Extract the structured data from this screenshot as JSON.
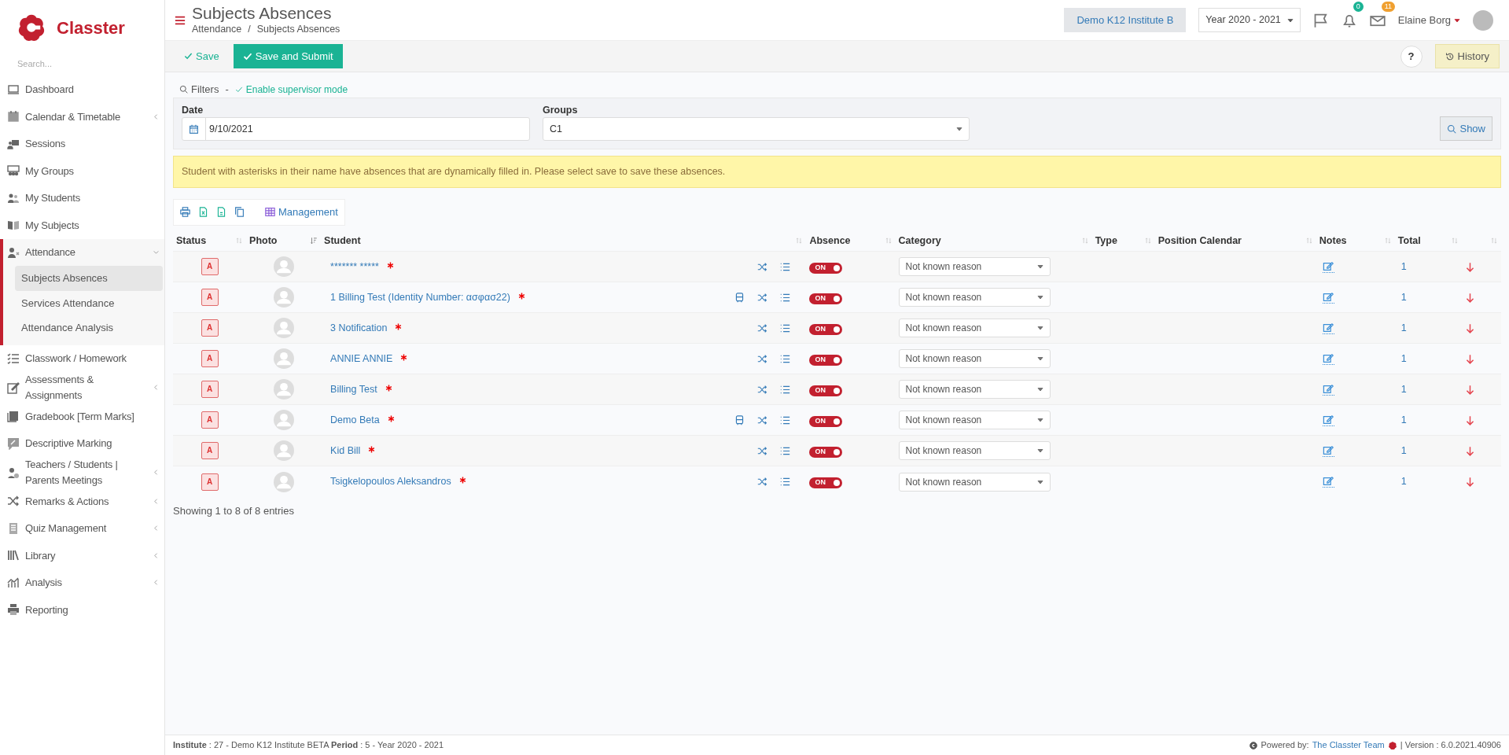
{
  "brand": {
    "name": "Classter"
  },
  "sidebar": {
    "search": {
      "placeholder": "Search..."
    },
    "items": [
      {
        "label": "Dashboard",
        "selected": false
      },
      {
        "label": "Calendar & Timetable",
        "selected": false,
        "expanded": false
      },
      {
        "label": "Sessions",
        "selected": false
      },
      {
        "label": "My Groups",
        "selected": false
      },
      {
        "label": "My Students",
        "selected": false
      },
      {
        "label": "My Subjects",
        "selected": false
      },
      {
        "label": "Attendance",
        "selected": false,
        "expanded": true,
        "children": [
          {
            "label": "Subjects Absences",
            "selected": true
          },
          {
            "label": "Services Attendance",
            "selected": false
          },
          {
            "label": "Attendance Analysis",
            "selected": false
          }
        ]
      },
      {
        "label": "Classwork / Homework",
        "selected": false
      },
      {
        "label": "Assessments & Assignments",
        "selected": false,
        "expanded": false
      },
      {
        "label": "Gradebook [Term Marks]",
        "selected": false
      },
      {
        "label": "Descriptive Marking",
        "selected": false
      },
      {
        "label": "Teachers / Students | Parents Meetings",
        "selected": false,
        "expanded": false
      },
      {
        "label": "Remarks & Actions",
        "selected": false,
        "expanded": false
      },
      {
        "label": "Quiz Management",
        "selected": false,
        "expanded": false
      },
      {
        "label": "Library",
        "selected": false,
        "expanded": false
      },
      {
        "label": "Analysis",
        "selected": false,
        "expanded": false
      },
      {
        "label": "Reporting",
        "selected": false
      }
    ]
  },
  "header": {
    "title": "Subjects Absences",
    "breadcrumb": [
      "Attendance",
      "Subjects Absences"
    ],
    "breadcrumb_separator": "/",
    "institute": "Demo K12 Institute B",
    "year": "Year 2020 - 2021",
    "notifications": "0",
    "messages": "11",
    "user": "Elaine Borg"
  },
  "toolbar": {
    "save": "Save",
    "submit": "Save and Submit",
    "help": "?",
    "history": "History"
  },
  "filters": {
    "label": "Filters",
    "separator": "-",
    "supervisor": "Enable supervisor mode",
    "date_label": "Date",
    "date": "9/10/2021",
    "groups_label": "Groups",
    "groups": "C1",
    "show": "Show"
  },
  "alert": "Student with asterisks in their name have absences that are dynamically filled in. Please select save to save these absences.",
  "table_tools": {
    "management": "Management"
  },
  "table": {
    "columns": [
      {
        "label": "Status",
        "sorted": false
      },
      {
        "label": "Photo",
        "sorted": true
      },
      {
        "label": "Student",
        "sorted": false
      },
      {
        "label": "Absence",
        "sorted": false
      },
      {
        "label": "Category",
        "sorted": false
      },
      {
        "label": "Type",
        "sorted": false
      },
      {
        "label": "Position Calendar",
        "sorted": false
      },
      {
        "label": "Notes",
        "sorted": false
      },
      {
        "label": "Total",
        "sorted": false
      },
      {
        "sorted": false
      }
    ],
    "rows": [
      {
        "status": "A",
        "student": "******* *****",
        "dynamic": true,
        "transport": false,
        "absence": {
          "on": true,
          "label": "ON"
        },
        "category": "Not known reason",
        "total": "1"
      },
      {
        "status": "A",
        "student": "1 Billing Test (Identity Number: ασφασ22)",
        "dynamic": true,
        "transport": true,
        "absence": {
          "on": true,
          "label": "ON"
        },
        "category": "Not known reason",
        "total": "1"
      },
      {
        "status": "A",
        "student": "3 Notification",
        "dynamic": true,
        "transport": false,
        "absence": {
          "on": true,
          "label": "ON"
        },
        "category": "Not known reason",
        "total": "1"
      },
      {
        "status": "A",
        "student": "ANNIE ANNIE",
        "dynamic": true,
        "transport": false,
        "absence": {
          "on": true,
          "label": "ON"
        },
        "category": "Not known reason",
        "total": "1"
      },
      {
        "status": "A",
        "student": "Billing Test",
        "dynamic": true,
        "transport": false,
        "absence": {
          "on": true,
          "label": "ON"
        },
        "category": "Not known reason",
        "total": "1"
      },
      {
        "status": "A",
        "student": "Demo Beta",
        "dynamic": true,
        "transport": true,
        "absence": {
          "on": true,
          "label": "ON"
        },
        "category": "Not known reason",
        "total": "1"
      },
      {
        "status": "A",
        "student": "Kid Bill",
        "dynamic": true,
        "transport": false,
        "absence": {
          "on": true,
          "label": "ON"
        },
        "category": "Not known reason",
        "total": "1"
      },
      {
        "status": "A",
        "student": "Tsigkelopoulos Aleksandros",
        "dynamic": true,
        "transport": false,
        "absence": {
          "on": true,
          "label": "ON"
        },
        "category": "Not known reason",
        "total": "1"
      }
    ],
    "info": "Showing 1 to 8 of 8 entries"
  },
  "footer": {
    "info": "**Institute** : 27 - Demo K12 Institute BETA **Period** : 5 - Year 2020 - 2021",
    "powered": "Powered by:",
    "team": "The Classter Team",
    "version": "| Version : 6.0.2021.40906"
  }
}
